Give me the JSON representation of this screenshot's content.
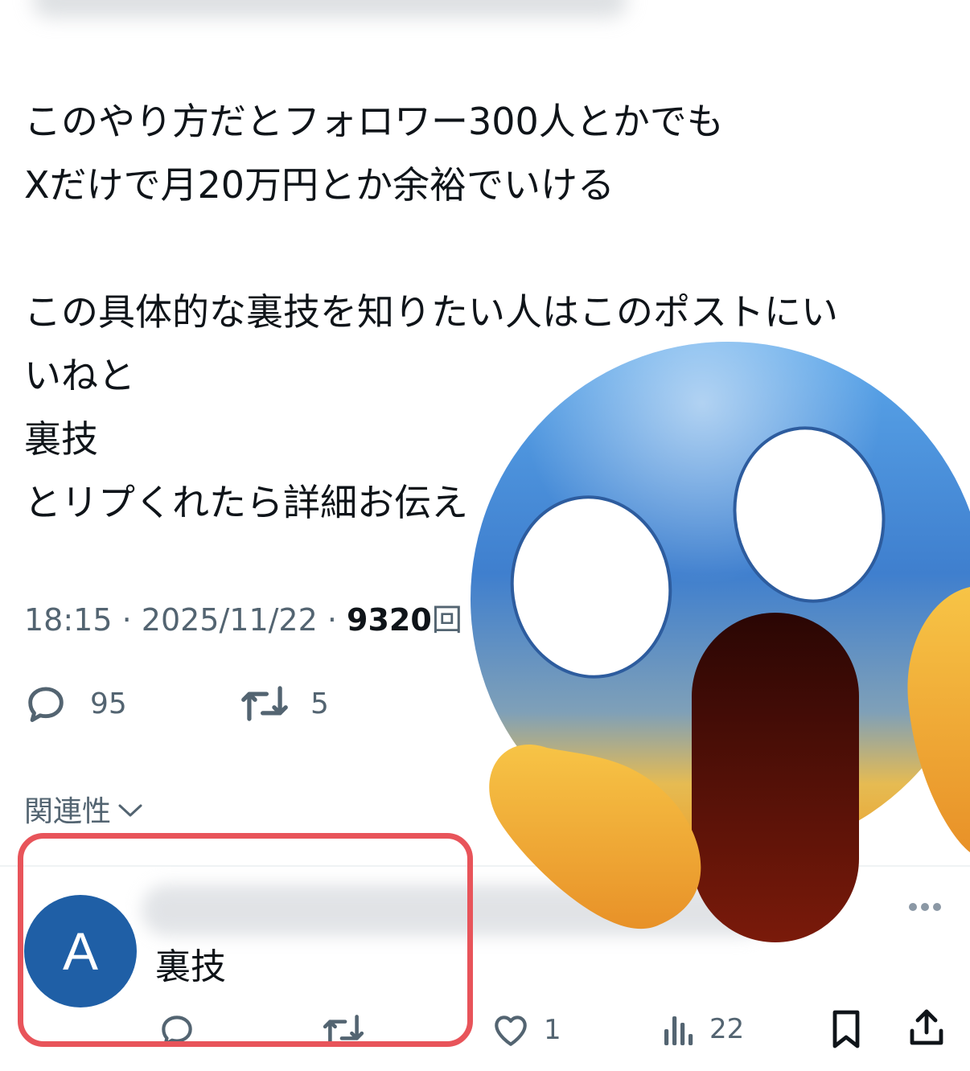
{
  "post": {
    "lines": [
      "このやり方だとフォロワー300人とかでも",
      "Xだけで月20万円とか余裕でいける",
      "",
      "この具体的な裏技を知りたい人はこのポストにい",
      "いねと",
      "裏技",
      "とリプくれたら詳細お伝え"
    ],
    "time": "18:15",
    "date": "2025/11/22",
    "views_count": "9320",
    "views_suffix": "回"
  },
  "actions": {
    "replies": "95",
    "reposts": "5"
  },
  "sort": {
    "label": "関連性"
  },
  "reply": {
    "avatar_letter": "A",
    "text": "裏技",
    "likes": "1",
    "views": "22"
  },
  "icons": {
    "reply": "reply-icon",
    "repost": "repost-icon",
    "like": "heart-icon",
    "views": "views-icon",
    "bookmark": "bookmark-icon",
    "share": "share-icon",
    "more": "more-icon",
    "sort_caret": "chevron-down-icon",
    "overlay": "screaming-face-emoji"
  },
  "colors": {
    "text_primary": "#0f1419",
    "text_secondary": "#536471",
    "avatar": "#1f5fa6",
    "highlight": "#e8545a"
  }
}
